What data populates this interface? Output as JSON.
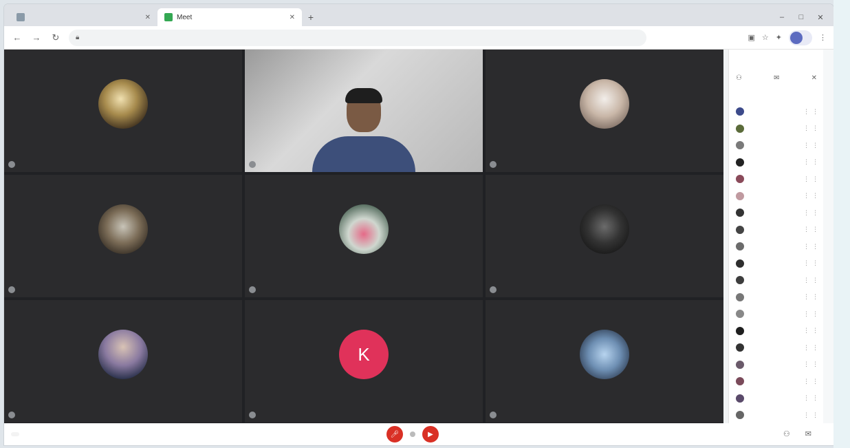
{
  "browser": {
    "tabs": [
      {
        "title": "",
        "active": false
      },
      {
        "title": "Meet",
        "active": true
      }
    ],
    "new_tab_icon": "plus-icon",
    "address": "",
    "profile": {
      "initial": "",
      "label": ""
    }
  },
  "tiles": [
    {
      "name": ""
    },
    {
      "name": ""
    },
    {
      "name": ""
    },
    {
      "name": ""
    },
    {
      "name": ""
    },
    {
      "name": ""
    },
    {
      "name": ""
    },
    {
      "name": "",
      "avatar_letter": "K"
    },
    {
      "name": ""
    }
  ],
  "bottom": {
    "meeting_code": "",
    "right_labels": [
      "",
      ""
    ]
  },
  "panel": {
    "title": "",
    "section": "",
    "participants": [
      {
        "name": ""
      },
      {
        "name": ""
      },
      {
        "name": ""
      },
      {
        "name": ""
      },
      {
        "name": ""
      },
      {
        "name": ""
      },
      {
        "name": ""
      },
      {
        "name": ""
      },
      {
        "name": ""
      },
      {
        "name": ""
      },
      {
        "name": ""
      },
      {
        "name": ""
      },
      {
        "name": ""
      },
      {
        "name": ""
      },
      {
        "name": ""
      },
      {
        "name": ""
      },
      {
        "name": ""
      },
      {
        "name": ""
      },
      {
        "name": ""
      },
      {
        "name": ""
      },
      {
        "name": ""
      }
    ]
  },
  "colors": {
    "meeting_bg": "#202124",
    "hangup_red": "#d93025",
    "avatar_pink": "#e0325a"
  }
}
